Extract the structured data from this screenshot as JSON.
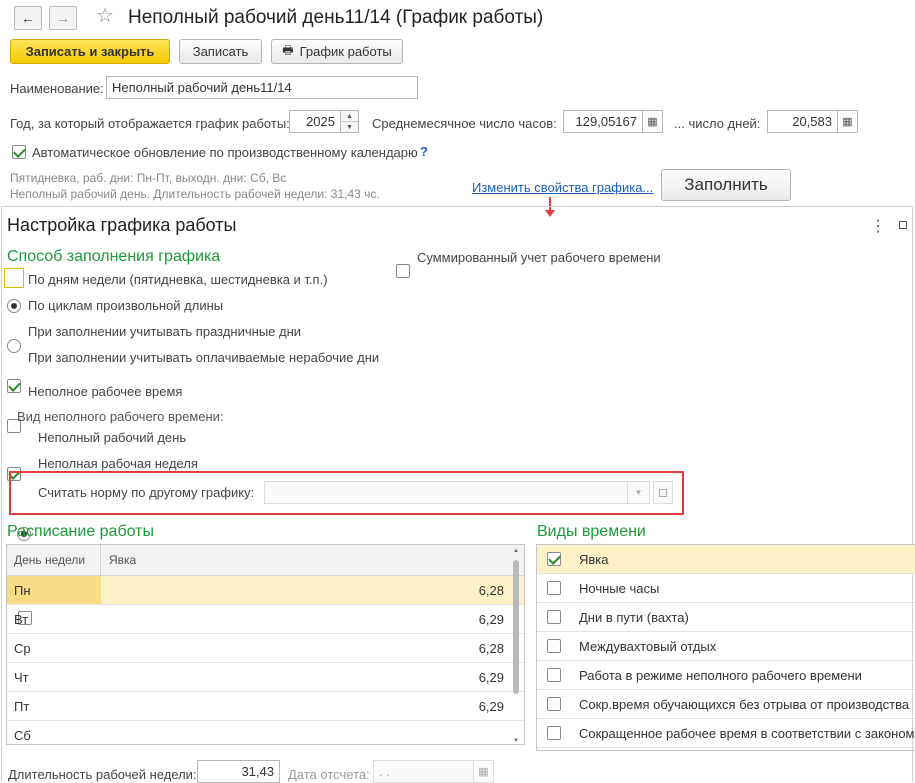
{
  "header": {
    "back": "←",
    "forward": "→",
    "star": "☆",
    "title": "Неполный рабочий день11/14 (График работы)"
  },
  "toolbar": {
    "save_close": "Записать и закрыть",
    "save": "Записать",
    "schedule": "График работы"
  },
  "form": {
    "name_label": "Наименование:",
    "name_value": "Неполный рабочий день11/14",
    "year_label": "Год, за который отображается график работы:",
    "year_value": "2025",
    "avg_hours_label": "Среднемесячное число часов:",
    "avg_hours_value": "129,05167",
    "days_label": "... число дней:",
    "days_value": "20,583",
    "auto_update_label": "Автоматическое обновление по производственному календарю",
    "help": "?",
    "info_line1": "Пятидневка, раб. дни: Пн-Пт, выходн. дни: Сб, Вс",
    "info_line2": "Неполный рабочий день. Длительность рабочей недели: 31,43 чс.",
    "change_props_link": "Изменить свойства графика...",
    "fill_button": "Заполнить"
  },
  "panel": {
    "title": "Настройка графика работы",
    "more": "⋮",
    "fill_method_title": "Способ заполнения графика",
    "summarized_label": "Суммированный учет рабочего времени",
    "radio_weekdays": "По дням недели (пятидневка, шестидневка и т.п.)",
    "radio_cycles": "По циклам произвольной длины",
    "cb_holidays": "При заполнении учитывать праздничные дни",
    "cb_paid_nonwork": "При заполнении учитывать оплачиваемые нерабочие дни",
    "cb_parttime": "Неполное рабочее время",
    "parttime_kind_label": "Вид неполного рабочего времени:",
    "radio_partday": "Неполный рабочий день",
    "radio_partweek": "Неполная рабочая неделя",
    "cb_norm_other": "Считать норму по другому графику:",
    "norm_other_value": ""
  },
  "schedule": {
    "title": "Расписание работы",
    "columns": [
      "День недели",
      "Явка"
    ],
    "rows": [
      {
        "day": "Пн",
        "value": "6,28"
      },
      {
        "day": "Вт",
        "value": "6,29"
      },
      {
        "day": "Ср",
        "value": "6,28"
      },
      {
        "day": "Чт",
        "value": "6,29"
      },
      {
        "day": "Пт",
        "value": "6,29"
      },
      {
        "day": "Сб",
        "value": ""
      }
    ],
    "duration_label": "Длительность рабочей недели:",
    "duration_value": "31,43",
    "ref_date_label": "Дата отсчета:",
    "ref_date_value": " .  ."
  },
  "time_types": {
    "title": "Виды времени",
    "items": [
      {
        "label": "Явка",
        "checked": true
      },
      {
        "label": "Ночные часы",
        "checked": false
      },
      {
        "label": "Дни в пути (вахта)",
        "checked": false
      },
      {
        "label": "Междувахтовый отдых",
        "checked": false
      },
      {
        "label": "Работа в режиме неполного рабочего времени",
        "checked": false
      },
      {
        "label": "Сокр.время обучающихся без отрыва от производства",
        "checked": false
      },
      {
        "label": "Сокращенное рабочее время в соответствии с законом",
        "checked": false
      }
    ]
  },
  "colors": {
    "accent_green": "#1c9a3a",
    "highlight_red": "#e03c3c",
    "selected_row": "#fdf1c8",
    "link": "#1f5fb5"
  }
}
